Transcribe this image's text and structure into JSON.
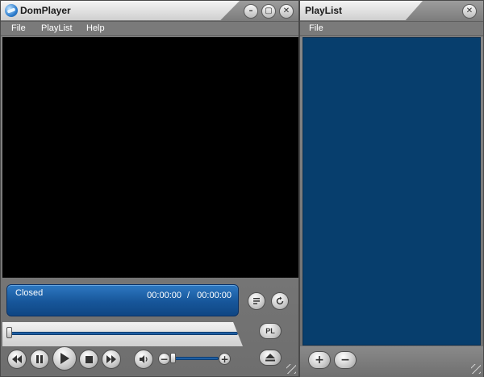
{
  "player": {
    "title": "DomPlayer",
    "window_buttons": {
      "minimize": "–",
      "restore": "▢",
      "close": "✕"
    },
    "menu": [
      "File",
      "PlayList",
      "Help"
    ],
    "status": {
      "text": "Closed",
      "time_current": "00:00:00",
      "time_separator": "/",
      "time_total": "00:00:00"
    },
    "side_buttons": {
      "pl_label": "PL"
    },
    "controls": {
      "seek_position": 0,
      "volume_level": 0
    }
  },
  "playlist": {
    "title": "PlayList",
    "menu": [
      "File"
    ],
    "buttons": {
      "add": "+",
      "remove": "−"
    }
  },
  "colors": {
    "status_blue": "#1c5fa5",
    "list_bg": "#073e6d",
    "video_bg": "#000000"
  }
}
